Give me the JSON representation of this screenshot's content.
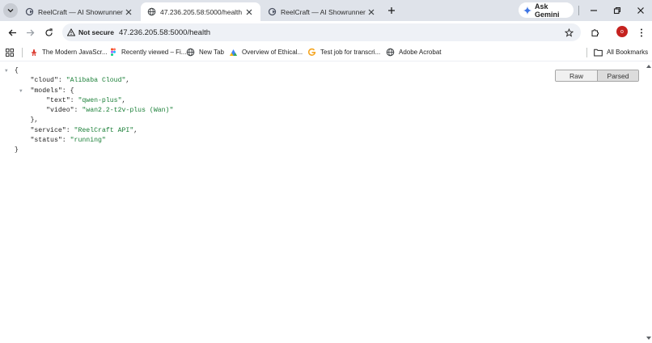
{
  "tabs": [
    {
      "title": "ReelCraft — AI Showrunner",
      "active": false
    },
    {
      "title": "47.236.205.58:5000/health",
      "active": true
    },
    {
      "title": "ReelCraft — AI Showrunner",
      "active": false
    }
  ],
  "gemini_label": "Ask Gemini",
  "omnibox": {
    "security_label": "Not secure",
    "url": "47.236.205.58:5000/health"
  },
  "avatar_letter": "o",
  "bookmarks": [
    {
      "label": "The Modern JavaScr...",
      "icon": "person-icon"
    },
    {
      "label": "Recently viewed – Fi...",
      "icon": "figma-icon"
    },
    {
      "label": "New Tab",
      "icon": "globe-icon"
    },
    {
      "label": "Overview of Ethical...",
      "icon": "triangle-icon"
    },
    {
      "label": "Test job for transcri...",
      "icon": "g-icon"
    },
    {
      "label": "Adobe Acrobat",
      "icon": "globe-icon"
    }
  ],
  "all_bookmarks_label": "All Bookmarks",
  "view_buttons": {
    "raw": "Raw",
    "parsed": "Parsed"
  },
  "json": {
    "open": "{",
    "cloud_key": "\"cloud\"",
    "cloud_val": "\"Alibaba Cloud\"",
    "models_key": "\"models\"",
    "models_open": "{",
    "text_key": "\"text\"",
    "text_val": "\"qwen-plus\"",
    "video_key": "\"video\"",
    "video_val": "\"wan2.2-t2v-plus (Wan)\"",
    "models_close": "},",
    "service_key": "\"service\"",
    "service_val": "\"ReelCraft API\"",
    "status_key": "\"status\"",
    "status_val": "\"running\"",
    "close": "}"
  },
  "colors": {
    "tabstrip": "#dfe3ea",
    "string": "#1a7f37",
    "avatar": "#c5221f"
  }
}
